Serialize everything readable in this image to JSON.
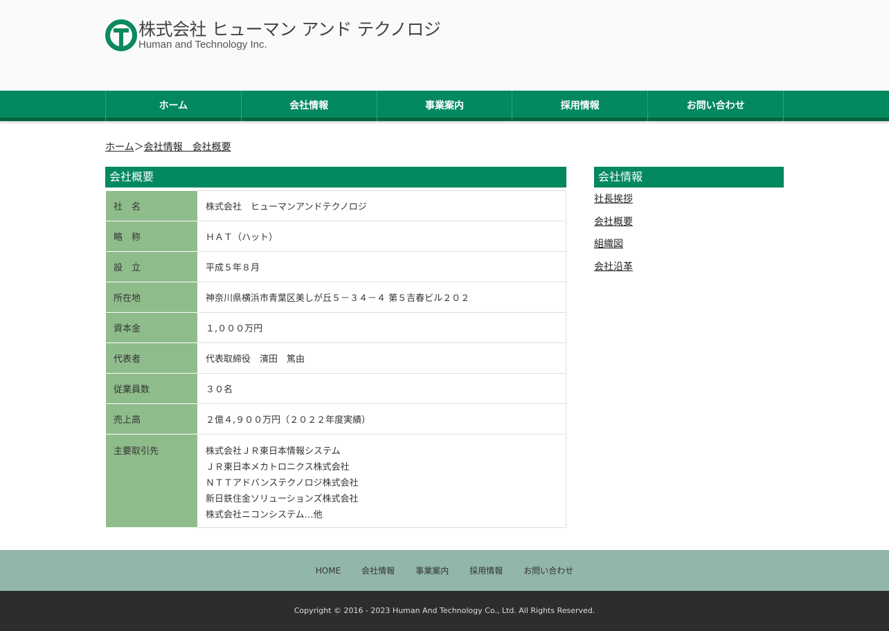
{
  "logo": {
    "jp": "株式会社 ヒューマン アンド テクノロジ",
    "en": "Human and Technology Inc."
  },
  "nav": [
    "ホーム",
    "会社情報",
    "事業案内",
    "採用情報",
    "お問い合わせ"
  ],
  "breadcrumb": {
    "home": "ホーム",
    "sep": "＞",
    "current": "会社情報　会社概要"
  },
  "main": {
    "title": "会社概要",
    "rows": [
      {
        "k": "社　名",
        "v": "株式会社　ヒューマンアンドテクノロジ"
      },
      {
        "k": "略　称",
        "v": "ＨＡＴ（ハット）"
      },
      {
        "k": "設　立",
        "v": "平成５年８月"
      },
      {
        "k": "所在地",
        "v": "神奈川県横浜市青葉区美しが丘５－３４－４ 第５吉春ビル２０２"
      },
      {
        "k": "資本金",
        "v": "１,０００万円"
      },
      {
        "k": "代表者",
        "v": "代表取締役　濱田　篤由"
      },
      {
        "k": "従業員数",
        "v": "３０名"
      },
      {
        "k": "売上高",
        "v": "２億４,９００万円（２０２２年度実績）"
      }
    ],
    "clients": {
      "k": "主要取引先",
      "v": [
        "株式会社ＪＲ東日本情報システム",
        "ＪＲ東日本メカトロニクス株式会社",
        "ＮＴＴアドバンステクノロジ株式会社",
        "新日鉄住金ソリューションズ株式会社",
        "株式会社ニコンシステム…他"
      ]
    }
  },
  "side": {
    "title": "会社情報",
    "links": [
      "社長挨拶",
      "会社概要",
      "組織図",
      "会社沿革"
    ]
  },
  "footer": {
    "links": [
      "HOME",
      "会社情報",
      "事業案内",
      "採用情報",
      "お問い合わせ"
    ],
    "copyright": "Copyright © 2016 - 2023 Human And Technology Co., Ltd. All Rights Reserved."
  }
}
